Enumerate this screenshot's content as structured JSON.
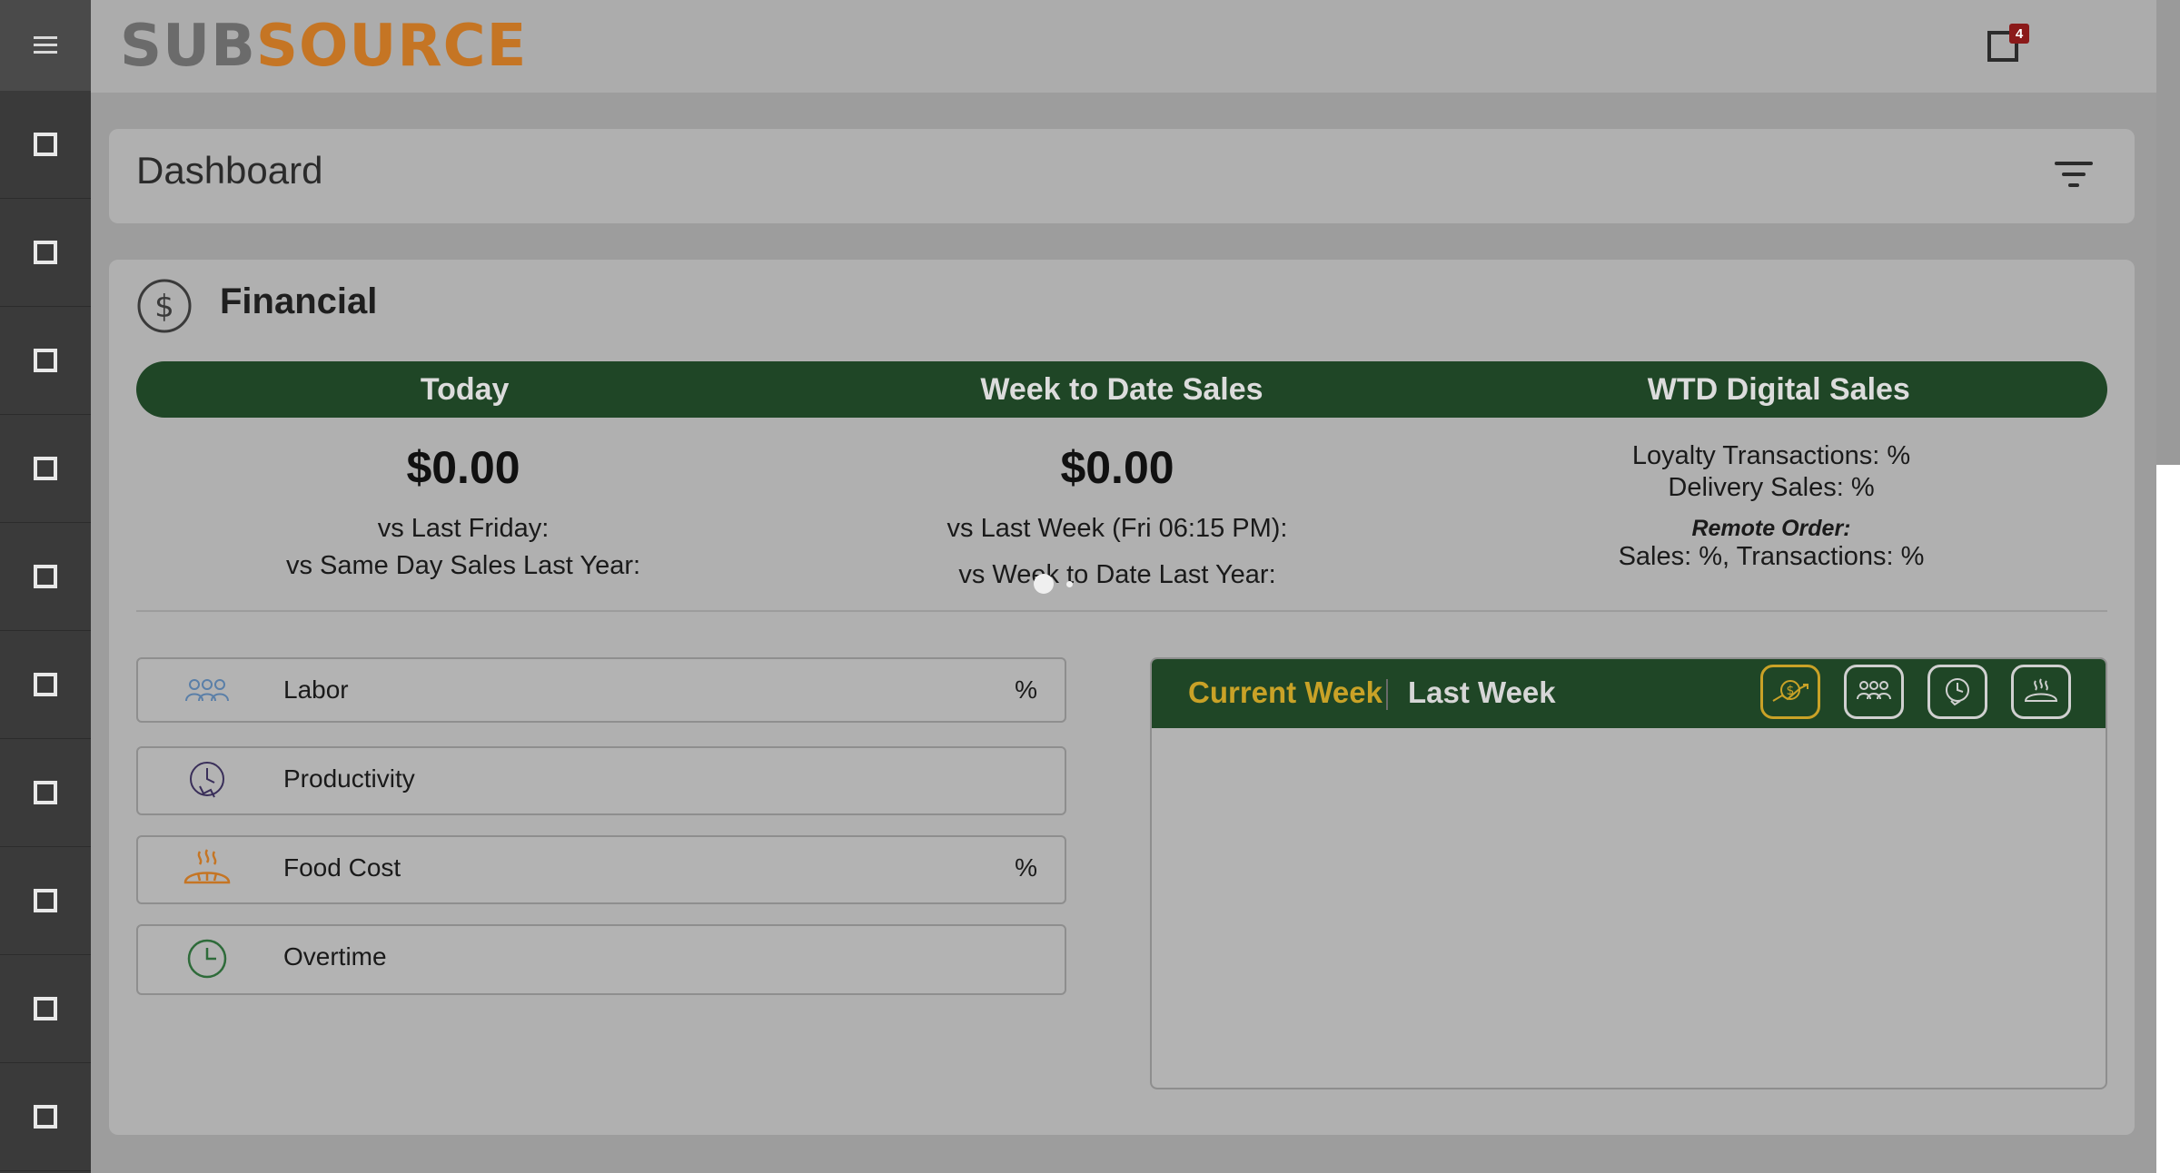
{
  "header": {
    "logo_sub": "SUB",
    "logo_source": "SOURCE",
    "notification_count": "4"
  },
  "colors": {
    "sidebar": "#3a3a3a",
    "brand_orange": "#c57524",
    "brand_green": "#1f4626",
    "accent_gold": "#c9a227",
    "badge_red": "#8b1a1a"
  },
  "sidebar": {
    "items": [
      "square-icon",
      "square-icon",
      "square-icon",
      "square-icon",
      "square-icon",
      "square-icon",
      "square-icon",
      "square-icon",
      "square-icon",
      "square-icon"
    ]
  },
  "dashboard": {
    "title": "Dashboard"
  },
  "financial": {
    "title": "Financial",
    "columns": [
      "Today",
      "Week to Date Sales",
      "WTD Digital Sales"
    ],
    "today": {
      "value": "$0.00",
      "vs_last_friday": "vs Last Friday:",
      "vs_same_day": "vs Same Day Sales Last Year:"
    },
    "week": {
      "value": "$0.00",
      "vs_last_week": "vs Last Week (Fri 06:15 PM):",
      "vs_week_last_year": "vs Week to Date Last Year:"
    },
    "digital": {
      "loyalty": "Loyalty Transactions: %",
      "delivery": "Delivery Sales: %",
      "remote_label": "Remote Order:",
      "remote_values": "Sales: %, Transactions: %"
    }
  },
  "kpis": [
    {
      "label": "Labor",
      "value": "%"
    },
    {
      "label": "Productivity",
      "value": ""
    },
    {
      "label": "Food Cost",
      "value": "%"
    },
    {
      "label": "Overtime",
      "value": ""
    }
  ],
  "chart_panel": {
    "tab_current": "Current Week",
    "tab_last": "Last Week"
  }
}
